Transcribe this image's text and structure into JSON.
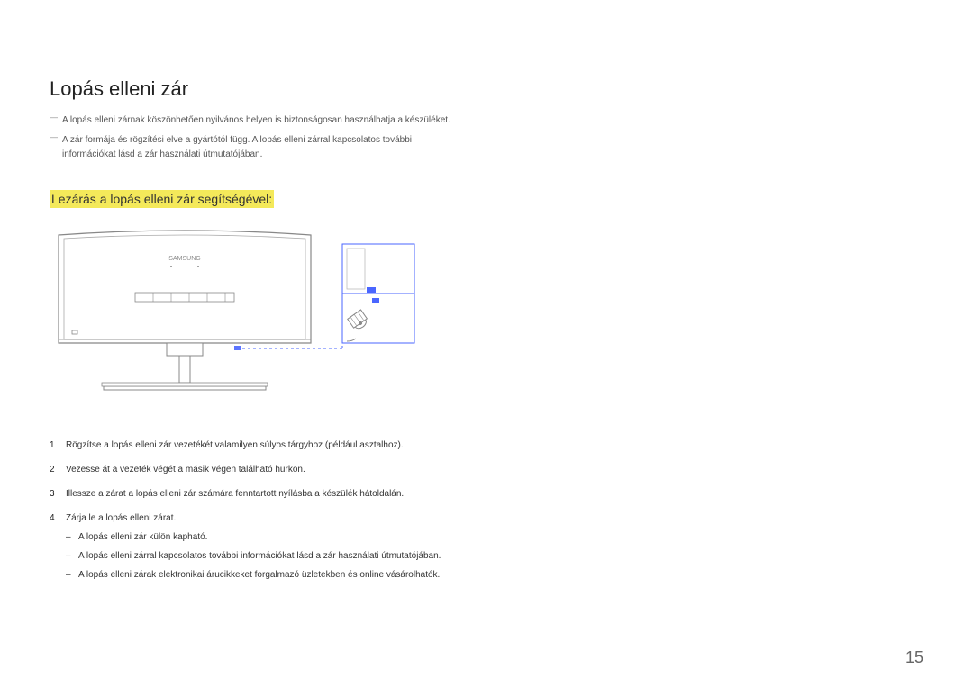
{
  "heading": "Lopás elleni zár",
  "notes": [
    "A lopás elleni zárnak köszönhetően nyilvános helyen is biztonságosan használhatja a készüléket.",
    "A zár formája és rögzítési elve a gyártótól függ. A lopás elleni zárral kapcsolatos további információkat lásd a zár használati útmutatójában."
  ],
  "subheading": "Lezárás a lopás elleni zár segítségével:",
  "diagram": {
    "brand": "SAMSUNG"
  },
  "steps": [
    {
      "num": "1",
      "text": "Rögzítse a lopás elleni zár vezetékét valamilyen súlyos tárgyhoz (például asztalhoz)."
    },
    {
      "num": "2",
      "text": "Vezesse át a vezeték végét a másik végen található hurkon."
    },
    {
      "num": "3",
      "text": "Illessze a zárat a lopás elleni zár számára fenntartott nyílásba a készülék hátoldalán."
    },
    {
      "num": "4",
      "text": "Zárja le a lopás elleni zárat."
    }
  ],
  "subitems": [
    "A lopás elleni zár külön kapható.",
    "A lopás elleni zárral kapcsolatos további információkat lásd a zár használati útmutatójában.",
    "A lopás elleni zárak elektronikai árucikkeket forgalmazó üzletekben és online vásárolhatók."
  ],
  "page_number": "15"
}
